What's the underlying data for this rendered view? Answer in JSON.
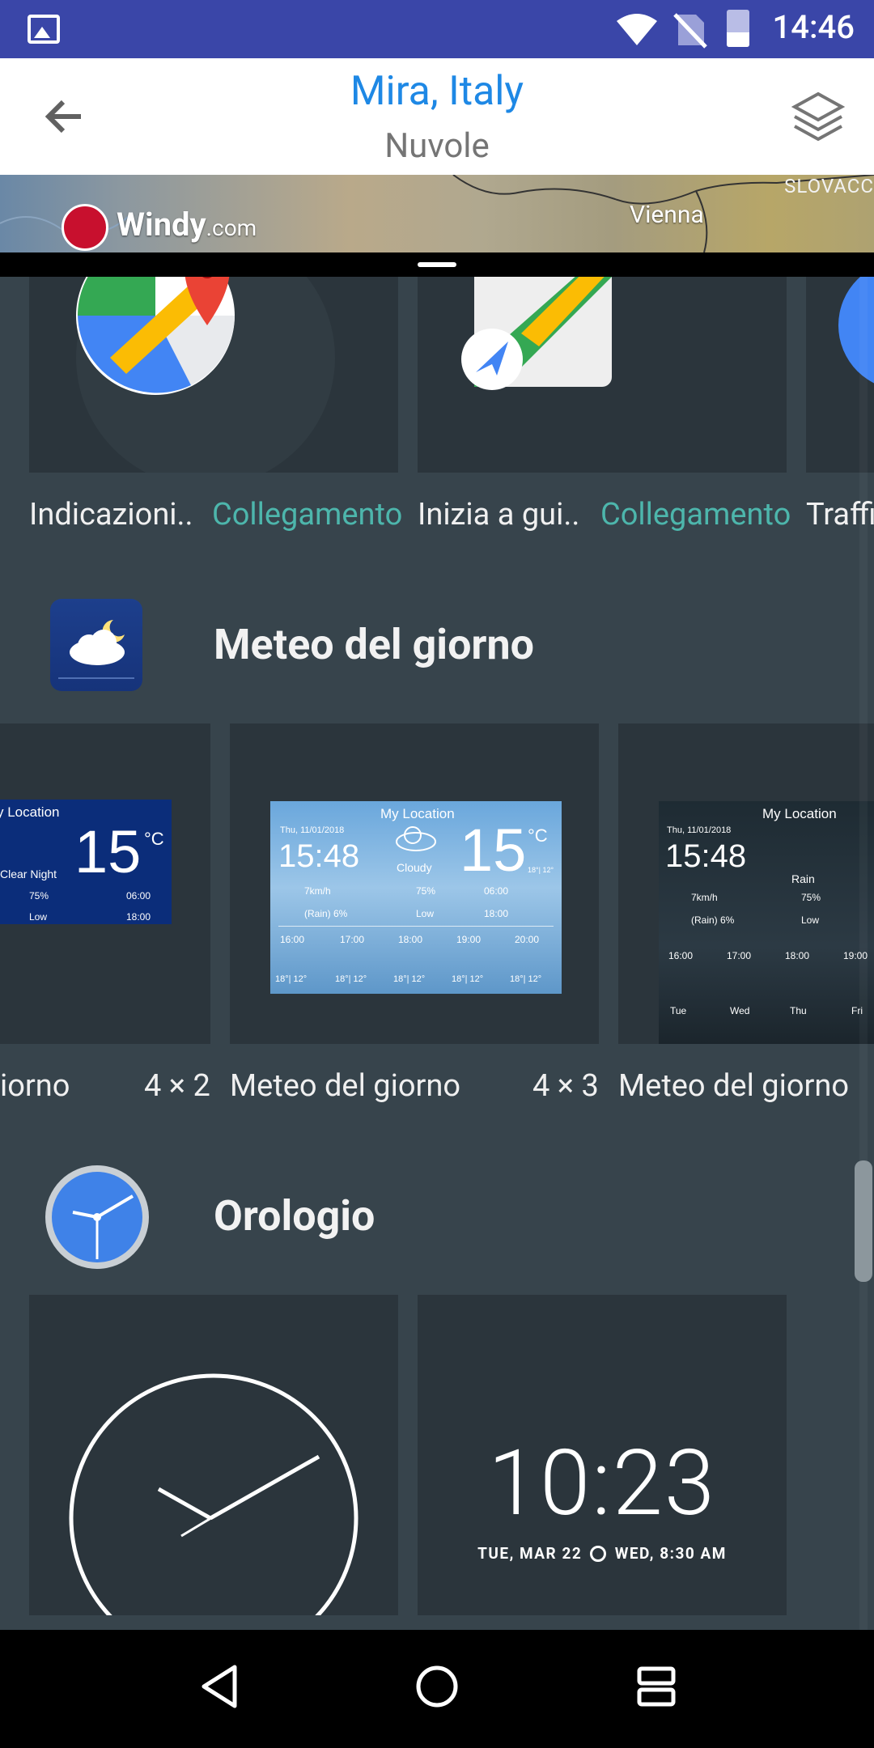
{
  "status_bar": {
    "time": "14:46"
  },
  "header": {
    "title": "Mira, Italy",
    "subtitle": "Nuvole"
  },
  "map": {
    "logo": "Windy",
    "logo_suffix": ".com",
    "city": "Vienna",
    "country": "SLOVACC"
  },
  "maps_row": {
    "items": [
      {
        "label": "Indicazioni..",
        "type": "Collegamento"
      },
      {
        "label": "Inizia a gui..",
        "type": "Collegamento"
      },
      {
        "label": "Traffi"
      }
    ]
  },
  "section_weather": {
    "title": "Meteo del giorno",
    "cards": [
      {
        "name": "iorno",
        "size": "4 × 2"
      },
      {
        "name": "Meteo del giorno",
        "size": "4 × 3"
      },
      {
        "name": "Meteo del giorno"
      }
    ],
    "preview": {
      "location": "My Location",
      "date": "Thu, 11/01/2018",
      "time": "15:48",
      "temp": "15",
      "unit": "°C",
      "hilo": "18°| 12°",
      "cond_night": "Clear Night",
      "cond_cloudy": "Cloudy",
      "cond_rain": "Rain",
      "wind": "7km/h",
      "humidity": "75%",
      "rain": "(Rain) 6%",
      "uv": "Low",
      "sunrise": "06:00",
      "sunset": "18:00",
      "hours": [
        "16:00",
        "17:00",
        "18:00",
        "19:00",
        "20:00"
      ],
      "hour_temps": "18°| 12°",
      "days": [
        "Tue",
        "Wed",
        "Thu",
        "Fri"
      ]
    }
  },
  "section_clock": {
    "title": "Orologio",
    "digital_time": "10:23",
    "digital_date": "TUE, MAR 22",
    "alarm": "WED, 8:30 AM"
  }
}
